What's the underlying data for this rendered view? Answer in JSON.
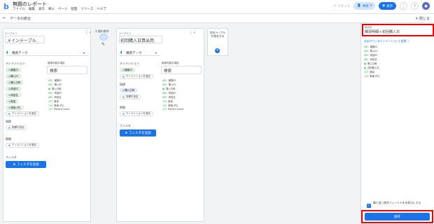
{
  "topbar": {
    "logo": "b",
    "title": "無題のレポート",
    "menu": [
      "ファイル",
      "編集",
      "表示",
      "挿入",
      "ページ",
      "配置",
      "リソース",
      "ヘルプ"
    ],
    "reset": "リセット",
    "share": "共有",
    "view": "表示"
  },
  "subbar": {
    "back_icon": "arrow-left",
    "title": "データの統合",
    "close": "閉じる"
  },
  "table1": {
    "label": "テーブル 1",
    "name": "メインテーブル",
    "source": "購買データ",
    "dim_header": "ディメンション",
    "available_header": "使用可能な項目",
    "search_placeholder": "検索",
    "dims": [
      "顧客ID",
      "購入ID",
      "購入日時",
      "商品ID",
      "商品名",
      "数量",
      "単価 (円)"
    ],
    "add_dimension": "ディメンションを追加",
    "metric_header": "指標",
    "add_metric": "指標を追加",
    "period_header": "期間",
    "add_period_dim": "ディメンションを追加",
    "filter_header": "フィルタ",
    "add_filter": "フィルタを追加",
    "fields": [
      "顧客ID",
      "購入ID",
      "購入日時",
      "商品ID",
      "商品名",
      "数量",
      "単価 (円)",
      "Record Count"
    ]
  },
  "join": {
    "label": "1 個の条件"
  },
  "table2": {
    "label": "テーブル 2",
    "name": "初回購入日算出用",
    "source": "購買データ",
    "dim_header": "ディメンション",
    "available_header": "使用可能な項目",
    "search_placeholder": "検索",
    "dims": [
      "顧客ID"
    ],
    "add_dimension": "ディメンションを追加",
    "metric_header": "指標",
    "metrics": [
      "購入日時"
    ],
    "add_metric": "指標を追加",
    "period_header": "期間",
    "add_period_dim": "ディメンションを追加",
    "filter_header": "フィルタ",
    "add_filter": "フィルタを追加",
    "fields": [
      "顧客ID",
      "購入ID",
      "購入日時",
      "商品ID",
      "商品名",
      "数量",
      "単価 (円)",
      "Record Count"
    ]
  },
  "add_table": {
    "label": "別のテーブルを結合する"
  },
  "right": {
    "name_label": "統合名",
    "name_value": "購買明細＋初回購入日",
    "included_label": "含まれているディメンションと指標",
    "included": [
      "顧客ID",
      "購入ID",
      "商品ID",
      "商品名",
      "購入日時",
      "初回購入日",
      "数量",
      "単価 (円)"
    ],
    "checkbox_label": "繰り返し統合フィールドを非表示にする",
    "save": "保存"
  },
  "colors": {
    "accent": "#1a73e8",
    "highlight": "#ea0000",
    "chip_green": "#e6f4ea"
  }
}
